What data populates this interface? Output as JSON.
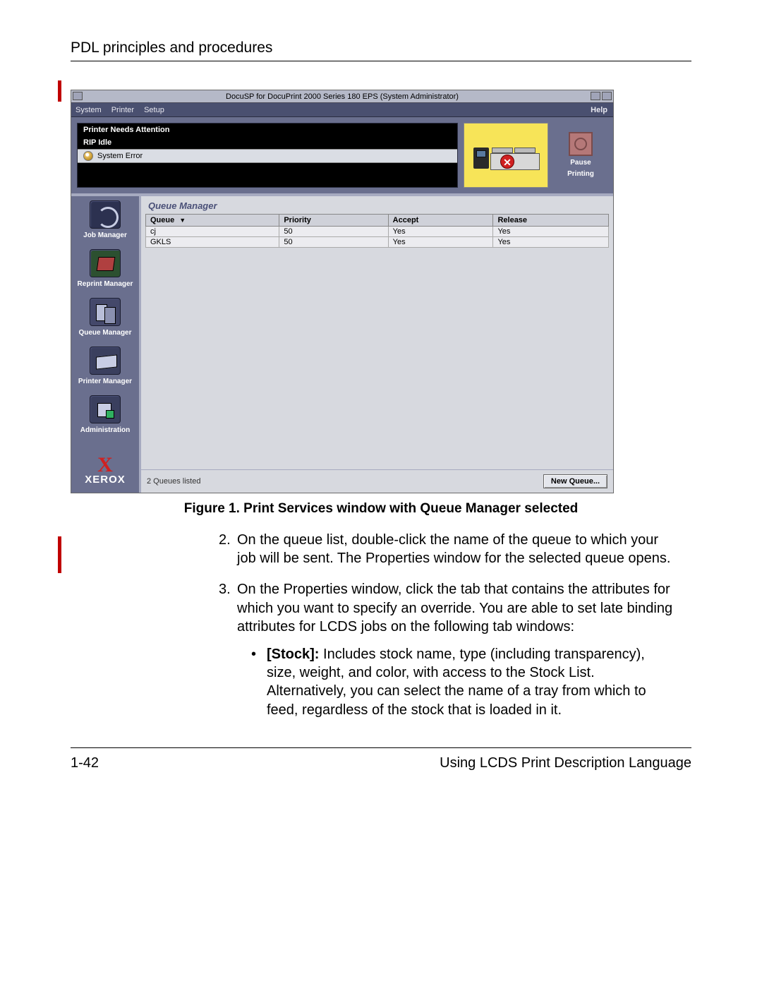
{
  "doc": {
    "header": "PDL principles and procedures",
    "page_number": "1-42",
    "footer_right": "Using LCDS Print Description Language",
    "figure_caption": "Figure 1. Print Services window with Queue Manager selected",
    "step2_num": "2.",
    "step2": "On the queue list, double-click the name of the queue to which your job will be sent. The Properties window for the selected queue opens.",
    "step3_num": "3.",
    "step3": "On the Properties window, click the tab that contains the attributes for which you want to specify an override. You are able to set late binding attributes for LCDS jobs on the following tab windows:",
    "bullet_stock_label": "[Stock]:",
    "bullet_stock_rest": "  Includes stock name, type (including transparency), size, weight, and color, with access to the Stock List. Alternatively, you can select the name of a tray from which to feed, regardless of the stock that is loaded in it."
  },
  "app": {
    "title": "DocuSP for DocuPrint 2000 Series 180 EPS (System Administrator)",
    "menu": {
      "system": "System",
      "printer": "Printer",
      "setup": "Setup",
      "help": "Help"
    },
    "status": {
      "line1": "Printer Needs Attention",
      "line2": "RIP Idle",
      "error_row": "System Error"
    },
    "pause": {
      "line1": "Pause",
      "line2": "Printing"
    },
    "sidebar": {
      "job": "Job Manager",
      "reprint": "Reprint Manager",
      "queue": "Queue Manager",
      "printer": "Printer Manager",
      "admin": "Administration",
      "brand": "XEROX"
    },
    "content": {
      "title": "Queue Manager",
      "col_queue": "Queue",
      "col_priority": "Priority",
      "col_accept": "Accept",
      "col_release": "Release",
      "rows": [
        {
          "queue": "cj",
          "priority": "50",
          "accept": "Yes",
          "release": "Yes"
        },
        {
          "queue": "GKLS",
          "priority": "50",
          "accept": "Yes",
          "release": "Yes"
        }
      ],
      "footer_count": "2 Queues listed",
      "new_queue": "New Queue..."
    }
  }
}
